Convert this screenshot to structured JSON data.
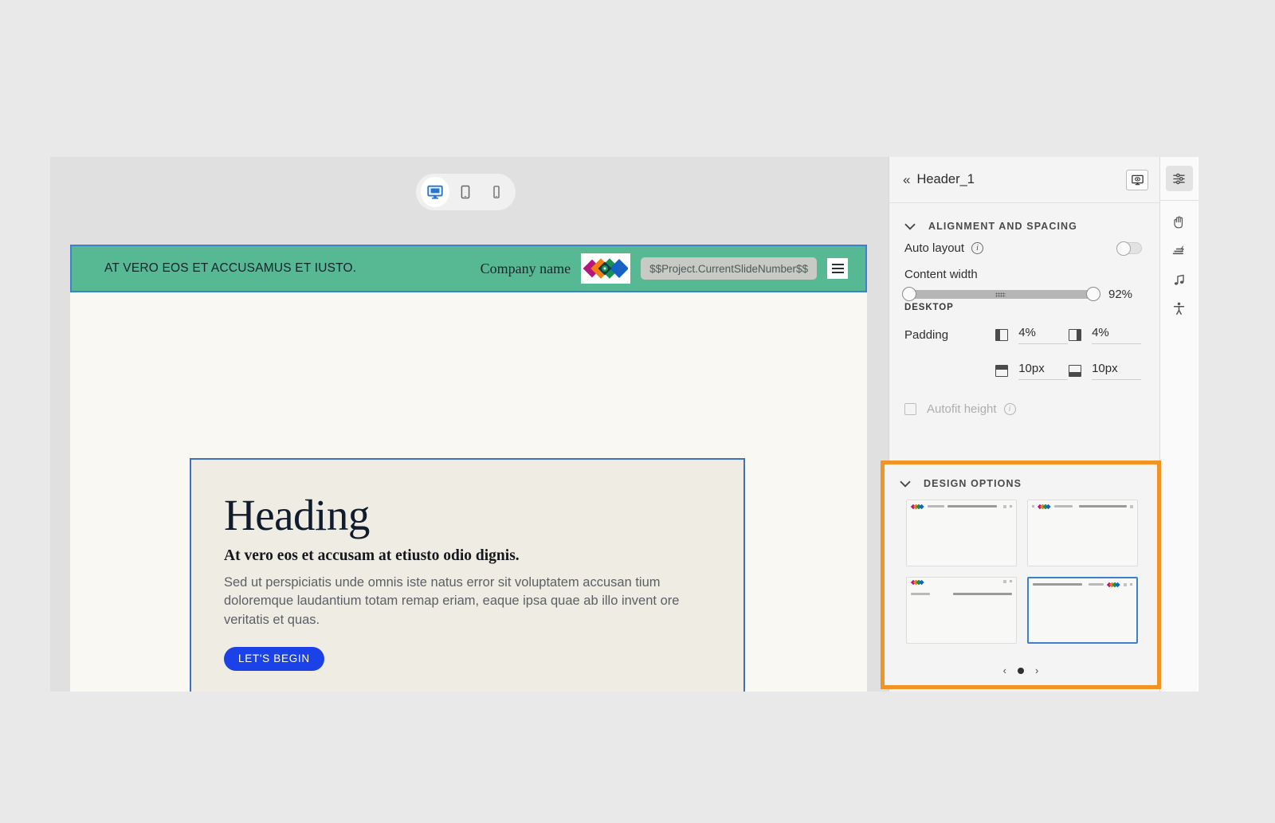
{
  "canvas": {
    "device_toggle": [
      {
        "name": "desktop",
        "label": "Desktop",
        "active": true
      },
      {
        "name": "tablet",
        "label": "Tablet",
        "active": false
      },
      {
        "name": "mobile",
        "label": "Mobile",
        "active": false
      }
    ],
    "slide": {
      "header": {
        "title": "AT VERO EOS ET ACCUSAMUS ET IUSTO.",
        "company_name": "Company name",
        "slide_number_token": "$$Project.CurrentSlideNumber$$",
        "background_color": "#57b894",
        "selection_color": "#3f7fd0",
        "logo_name": "company-logo-diamonds",
        "menu_icon": "hamburger-menu-icon"
      },
      "content": {
        "heading": "Heading",
        "subheading": "At vero eos et accusam at etiusto odio dignis.",
        "body": "Sed ut perspiciatis unde omnis iste natus error sit voluptatem accusan tium doloremque laudantium totam remap eriam, eaque ipsa quae ab illo invent ore veritatis et quas.",
        "cta_label": "LET'S BEGIN",
        "cta_color": "#1b41e8",
        "background_color": "#eeece3"
      }
    }
  },
  "properties": {
    "back_icon": "chevron-double-left-icon",
    "title": "Header_1",
    "preview_icon": "preview-monitor-icon",
    "alignment_section": {
      "title": "ALIGNMENT AND SPACING",
      "collapse_icon": "chevron-down-icon",
      "auto_layout": {
        "label": "Auto layout",
        "info_icon": "info-icon",
        "enabled": false
      },
      "content_width": {
        "label": "Content width",
        "value": "92%",
        "percent": 92
      },
      "device_label": "DESKTOP",
      "padding": {
        "label": "Padding",
        "left": {
          "icon": "padding-left-icon",
          "value": "4%"
        },
        "right": {
          "icon": "padding-right-icon",
          "value": "4%"
        },
        "top": {
          "icon": "padding-top-icon",
          "value": "10px"
        },
        "bottom": {
          "icon": "padding-bottom-icon",
          "value": "10px"
        }
      },
      "autofit_height": {
        "label": "Autofit height",
        "checked": false,
        "info_icon": "info-icon",
        "disabled": true
      }
    },
    "design_section": {
      "title": "DESIGN OPTIONS",
      "collapse_icon": "chevron-down-icon",
      "highlight_color": "#f29423",
      "thumbnails": [
        {
          "id": 1,
          "layout": "logo-left",
          "company": "Company name",
          "title": "AT VERO EOS ET ACCUSAMUS ET IUSTO.",
          "selected": false
        },
        {
          "id": 2,
          "layout": "menu-logo-left",
          "company": "Company name",
          "title": "AT VERO EOS ET ACCUSAMUS ET IUSTO.",
          "selected": false
        },
        {
          "id": 3,
          "layout": "logo-stacked-left",
          "company": "Company name",
          "title": "AT VERO EOS ET ACCUSAMUS ET IUSTO.",
          "selected": false
        },
        {
          "id": 4,
          "layout": "title-left-logo-right",
          "company": "Company name",
          "title": "AT VERO EOS ET ACCUSAMUS ET IUSTO.",
          "selected": true
        }
      ],
      "carousel": {
        "prev_icon": "chevron-left-icon",
        "next_icon": "chevron-right-icon",
        "page_dot": "active-page-dot"
      }
    }
  },
  "rail": {
    "items": [
      {
        "name": "properties-icon",
        "label": "Properties",
        "active": true
      },
      {
        "name": "interactions-hand-icon",
        "label": "Interactions",
        "active": false
      },
      {
        "name": "animation-motion-icon",
        "label": "Animation",
        "active": false
      },
      {
        "name": "audio-music-icon",
        "label": "Audio",
        "active": false
      },
      {
        "name": "accessibility-person-icon",
        "label": "Accessibility",
        "active": false
      }
    ]
  }
}
